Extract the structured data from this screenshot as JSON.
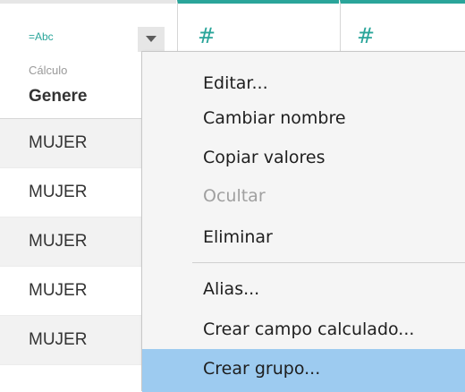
{
  "columns": [
    {
      "type_label": "=Abc",
      "subtitle": "Cálculo",
      "name": "Genere"
    },
    {
      "type_symbol": "#"
    },
    {
      "type_symbol": "#"
    }
  ],
  "rows": [
    "MUJER",
    "MUJER",
    "MUJER",
    "MUJER",
    "MUJER"
  ],
  "context_menu": {
    "items": [
      {
        "label": "Editar...",
        "state": "enabled"
      },
      {
        "label": "Cambiar nombre",
        "state": "enabled"
      },
      {
        "label": "Copiar valores",
        "state": "enabled"
      },
      {
        "label": "Ocultar",
        "state": "disabled"
      },
      {
        "label": "Eliminar",
        "state": "enabled"
      },
      {
        "label": "Alias...",
        "state": "enabled"
      },
      {
        "label": "Crear campo calculado...",
        "state": "enabled"
      },
      {
        "label": "Crear grupo...",
        "state": "hovered"
      }
    ]
  },
  "colors": {
    "accent": "#2aa59a",
    "highlight": "#9dcbf0"
  },
  "icons": {
    "dropdown": "chevron-down-icon",
    "measure": "hash-icon"
  }
}
